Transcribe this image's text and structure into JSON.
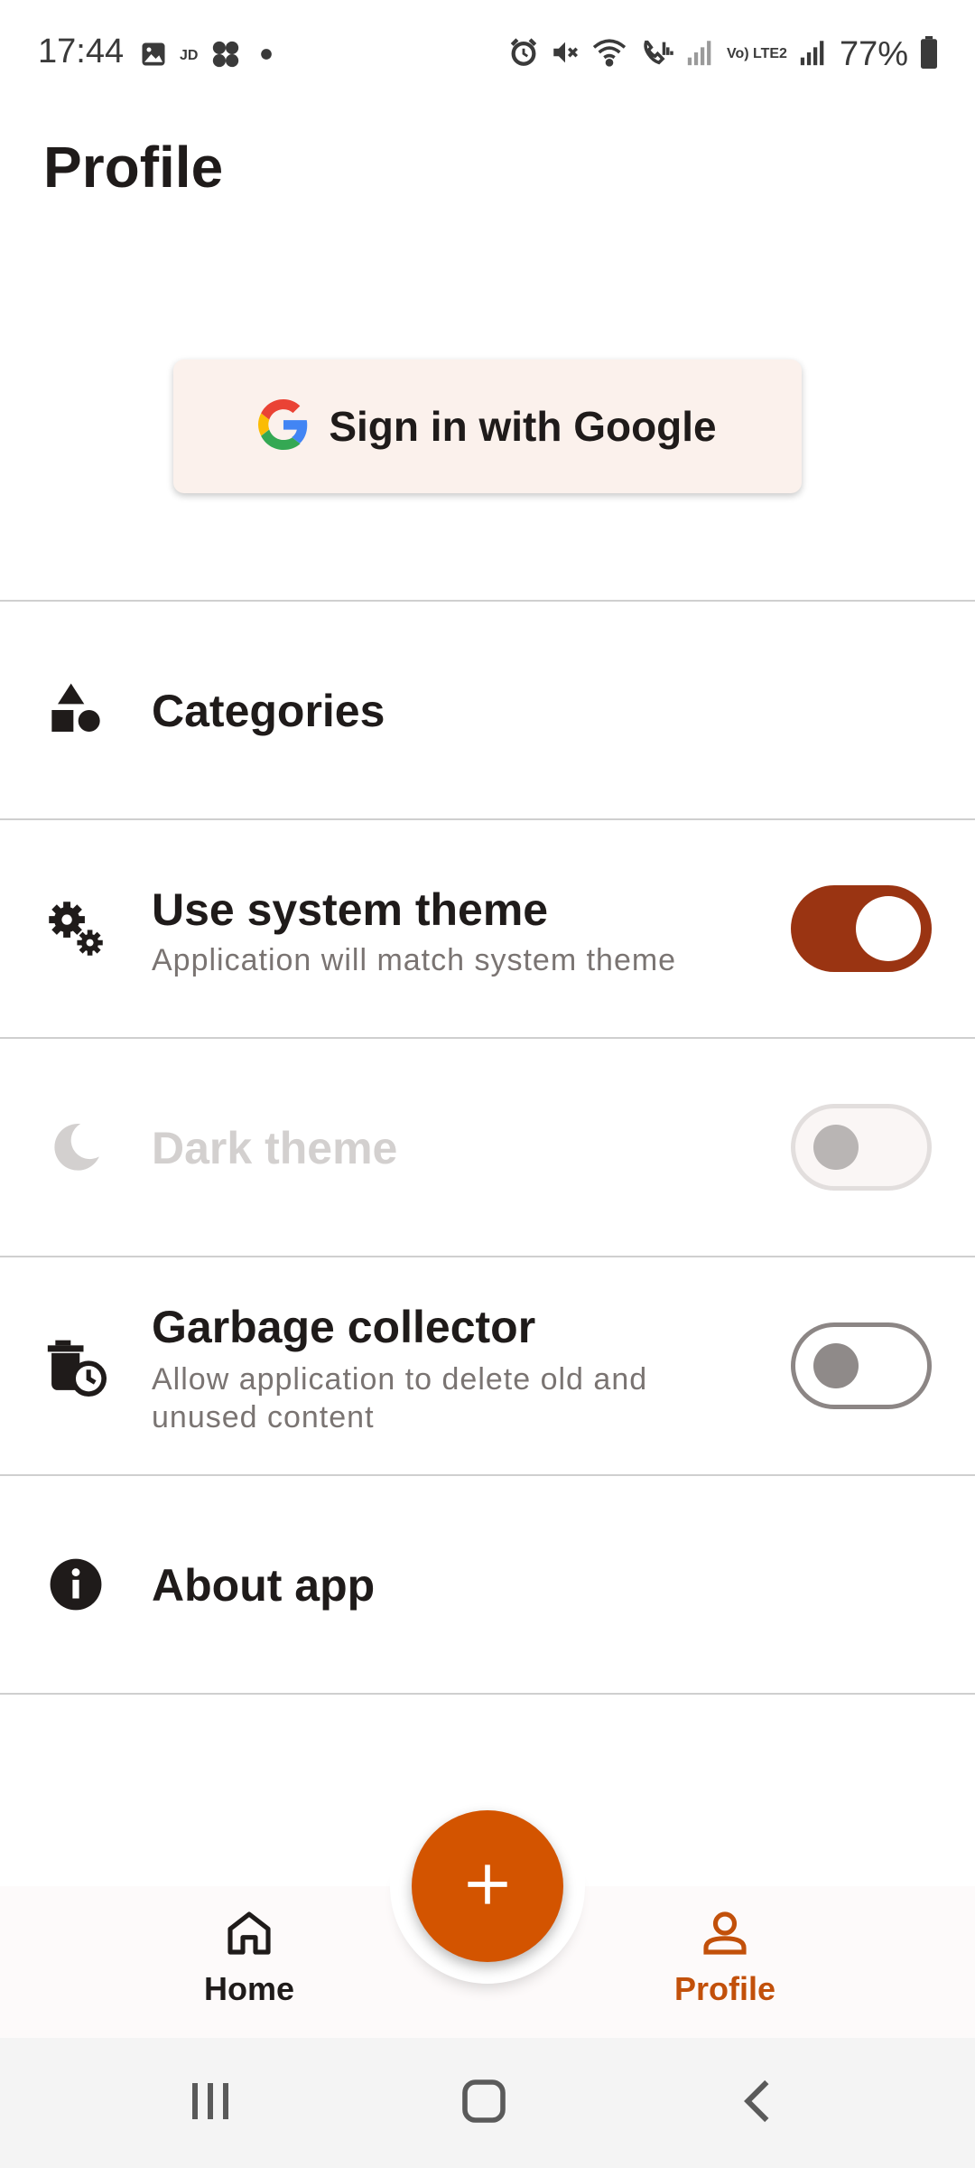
{
  "status_bar": {
    "time": "17:44",
    "battery": "77%",
    "left_icons": [
      "image-icon",
      "jd-icon",
      "fan-icon",
      "dot-icon"
    ],
    "right_icons": [
      "alarm-icon",
      "mute-icon",
      "wifi-icon",
      "wifi-call-icon",
      "signal-icon",
      "volte-icon",
      "signal-icon",
      "battery-icon"
    ],
    "jd_text": "JD",
    "volte_text": "Vo) LTE2"
  },
  "header": {
    "title": "Profile"
  },
  "google_button": {
    "label": "Sign in with Google",
    "icon": "google-icon"
  },
  "settings": {
    "categories": {
      "title": "Categories",
      "icon": "shapes-icon"
    },
    "system_theme": {
      "title": "Use system theme",
      "subtitle": "Application will match system theme",
      "icon": "gears-icon",
      "enabled": true
    },
    "dark_theme": {
      "title": "Dark theme",
      "icon": "moon-icon",
      "enabled": false,
      "disabled": true
    },
    "garbage_collector": {
      "title": "Garbage collector",
      "subtitle": "Allow application to delete old and unused content",
      "icon": "trash-clock-icon",
      "enabled": false
    },
    "about": {
      "title": "About app",
      "icon": "info-icon"
    }
  },
  "bottom_nav": {
    "home_label": "Home",
    "profile_label": "Profile",
    "active": "Profile",
    "fab_icon": "plus-icon"
  },
  "colors": {
    "accent": "#d35400",
    "toggle_on": "#9a3412",
    "active_nav": "#c2500a",
    "google_button_bg": "#fbf1ec"
  }
}
